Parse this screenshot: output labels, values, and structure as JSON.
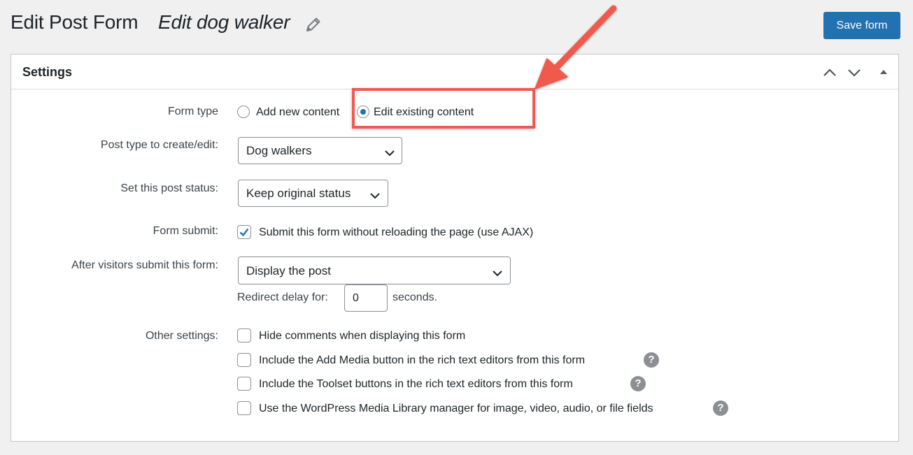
{
  "header": {
    "title": "Edit Post Form",
    "form_name": "Edit dog walker",
    "save_label": "Save form"
  },
  "panel": {
    "title": "Settings"
  },
  "form_type": {
    "label": "Form type",
    "options": [
      {
        "label": "Add new content",
        "selected": false
      },
      {
        "label": "Edit existing content",
        "selected": true
      }
    ]
  },
  "post_type": {
    "label": "Post type to create/edit:",
    "value": "Dog walkers"
  },
  "post_status": {
    "label": "Set this post status:",
    "value": "Keep original status"
  },
  "form_submit": {
    "label": "Form submit:",
    "checkbox_label": "Submit this form without reloading the page (use AJAX)",
    "checked": true
  },
  "after_submit": {
    "label": "After visitors submit this form:",
    "value": "Display the post",
    "redirect_prefix": "Redirect delay for:",
    "redirect_value": "0",
    "redirect_suffix": "seconds."
  },
  "other_settings": {
    "label": "Other settings:",
    "items": [
      {
        "label": "Hide comments when displaying this form",
        "checked": false,
        "help": false
      },
      {
        "label": "Include the Add Media button in the rich text editors from this form",
        "checked": false,
        "help": true
      },
      {
        "label": "Include the Toolset buttons in the rich text editors from this form",
        "checked": false,
        "help": true
      },
      {
        "label": "Use the WordPress Media Library manager for image, video, audio, or file fields",
        "checked": false,
        "help": true
      }
    ],
    "help_glyph": "?"
  },
  "annotation": {
    "color": "#f05a4e"
  },
  "colors": {
    "accent": "#2271b1",
    "background": "#f0f0f1"
  }
}
